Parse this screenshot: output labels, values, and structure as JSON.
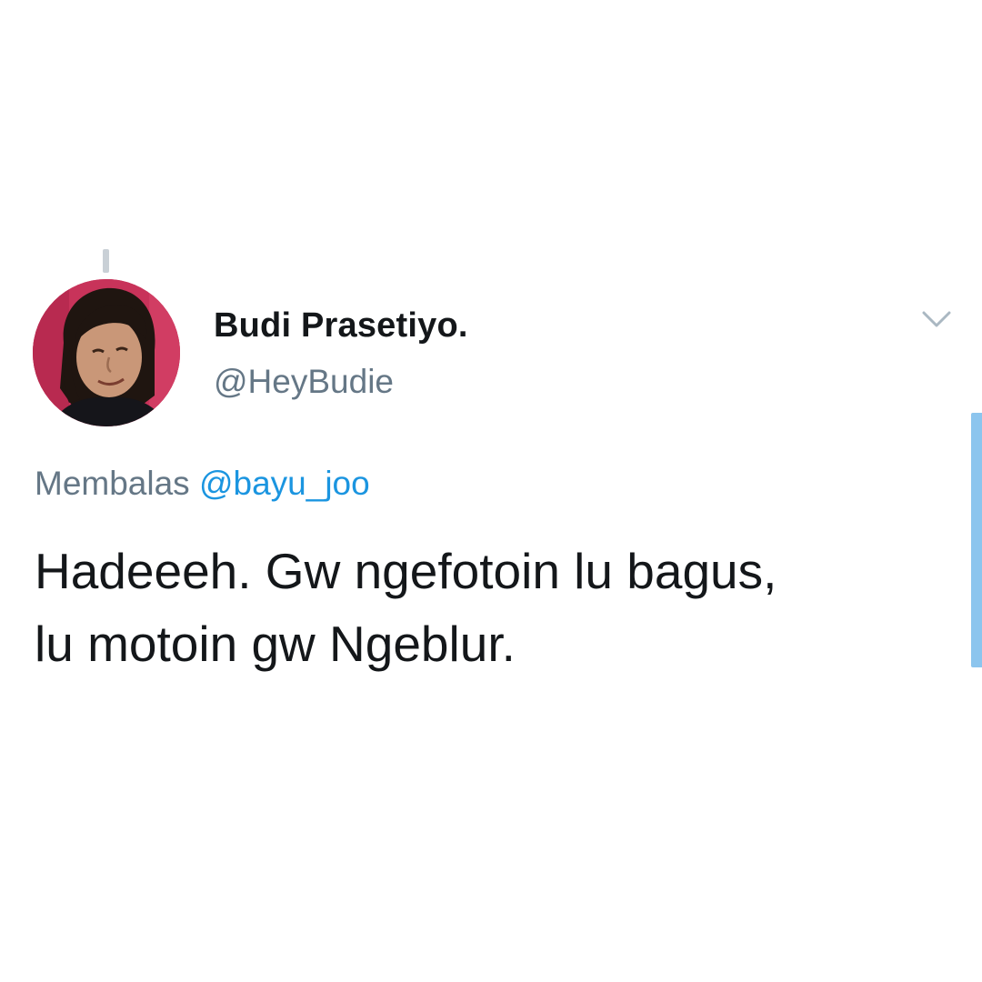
{
  "tweet": {
    "author": {
      "display_name": "Budi Prasetiyo.",
      "handle": "@HeyBudie",
      "avatar_icon": "profile-photo",
      "avatar_bg": "#c8335a"
    },
    "reply_prefix": "Membalas",
    "reply_to": "@bayu_joo",
    "text_lines": [
      "Hadeeeh. Gw ngefotoin lu bagus,",
      "lu motoin gw Ngeblur."
    ],
    "menu_icon": "chevron-down-icon"
  },
  "colors": {
    "text_primary": "#14171a",
    "text_secondary": "#657786",
    "link": "#1b95e0",
    "scrollbar": "#8cc5ee",
    "thread_line": "#c9d0d6"
  }
}
